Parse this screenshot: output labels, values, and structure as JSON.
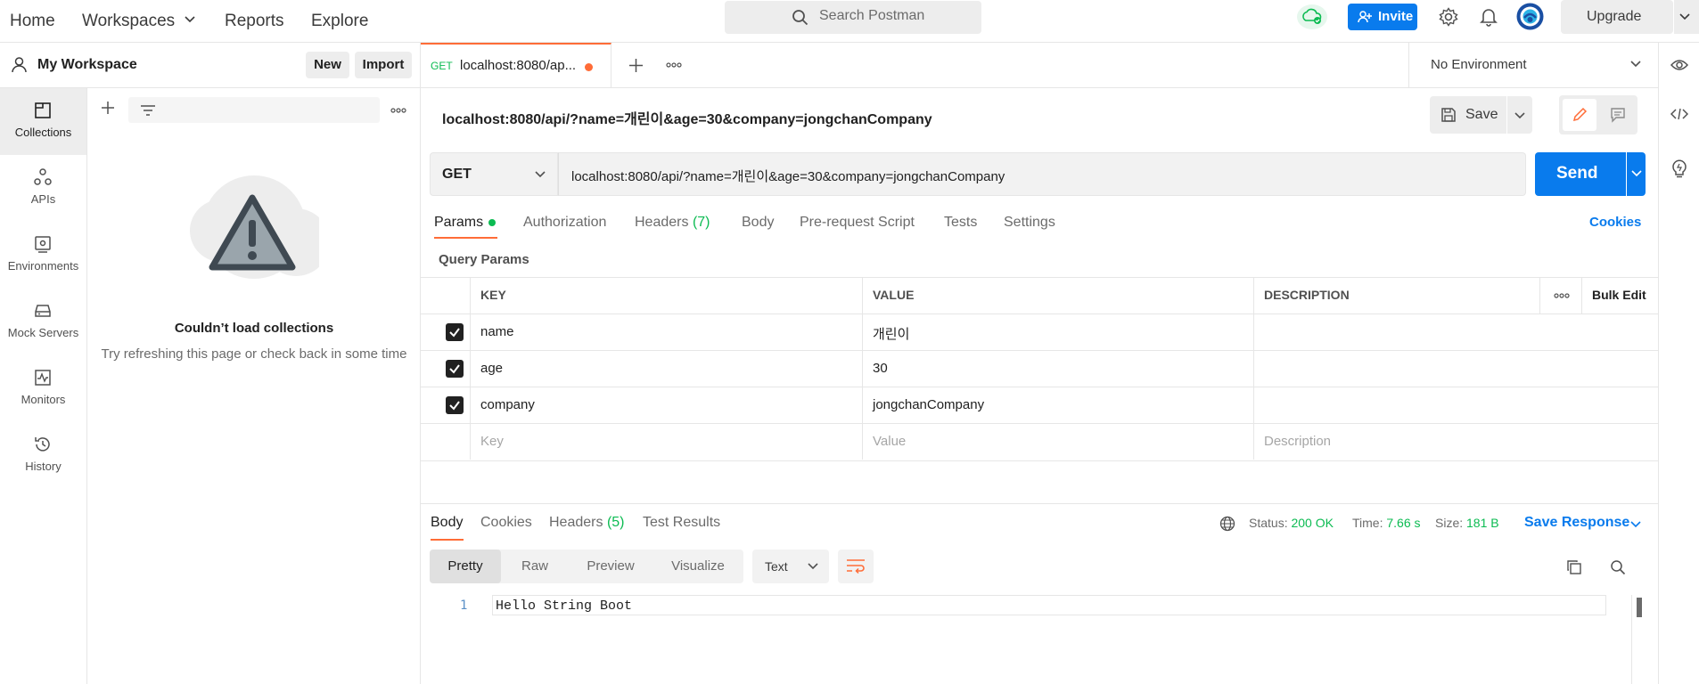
{
  "nav": {
    "home": "Home",
    "workspaces": "Workspaces",
    "reports": "Reports",
    "explore": "Explore",
    "search_placeholder": "Search Postman",
    "invite": "Invite",
    "upgrade": "Upgrade"
  },
  "workspace": {
    "title": "My Workspace",
    "new_label": "New",
    "import_label": "Import"
  },
  "rail": {
    "items": [
      {
        "label": "Collections",
        "icon": "collections-icon"
      },
      {
        "label": "APIs",
        "icon": "apis-icon"
      },
      {
        "label": "Environments",
        "icon": "environments-icon"
      },
      {
        "label": "Mock Servers",
        "icon": "mock-servers-icon"
      },
      {
        "label": "Monitors",
        "icon": "monitors-icon"
      },
      {
        "label": "History",
        "icon": "history-icon"
      }
    ]
  },
  "collections": {
    "empty_title": "Couldn’t load collections",
    "empty_subtitle": "Try refreshing this page or check back in some time"
  },
  "tabs": {
    "active": {
      "method": "GET",
      "name": "localhost:8080/ap..."
    },
    "environment": "No Environment"
  },
  "request": {
    "title": "localhost:8080/api/?name=개린이&age=30&company=jongchanCompany",
    "save_label": "Save",
    "method": "GET",
    "url": "localhost:8080/api/?name=개린이&age=30&company=jongchanCompany",
    "send_label": "Send",
    "subtabs": {
      "params": "Params",
      "authorization": "Authorization",
      "headers": "Headers",
      "headers_count": "(7)",
      "body": "Body",
      "prerequest": "Pre-request Script",
      "tests": "Tests",
      "settings": "Settings"
    },
    "cookies_link": "Cookies",
    "query_params_label": "Query Params"
  },
  "params_table": {
    "headers": {
      "key": "KEY",
      "value": "VALUE",
      "description": "DESCRIPTION",
      "bulk_edit": "Bulk Edit"
    },
    "rows": [
      {
        "key": "name",
        "value": "개린이",
        "description": ""
      },
      {
        "key": "age",
        "value": "30",
        "description": ""
      },
      {
        "key": "company",
        "value": "jongchanCompany",
        "description": ""
      }
    ],
    "placeholder": {
      "key": "Key",
      "value": "Value",
      "description": "Description"
    }
  },
  "response": {
    "tabs": {
      "body": "Body",
      "cookies": "Cookies",
      "headers": "Headers",
      "headers_count": "(5)",
      "test_results": "Test Results"
    },
    "status_label": "Status:",
    "status_value": "200 OK",
    "time_label": "Time:",
    "time_value": "7.66 s",
    "size_label": "Size:",
    "size_value": "181 B",
    "save_response": "Save Response",
    "formats": {
      "pretty": "Pretty",
      "raw": "Raw",
      "preview": "Preview",
      "visualize": "Visualize"
    },
    "language": "Text",
    "line_number": "1",
    "body_text": "Hello String Boot"
  },
  "colors": {
    "accent": "#ff6c37",
    "primary": "#097bed",
    "success": "#0cbb52"
  }
}
